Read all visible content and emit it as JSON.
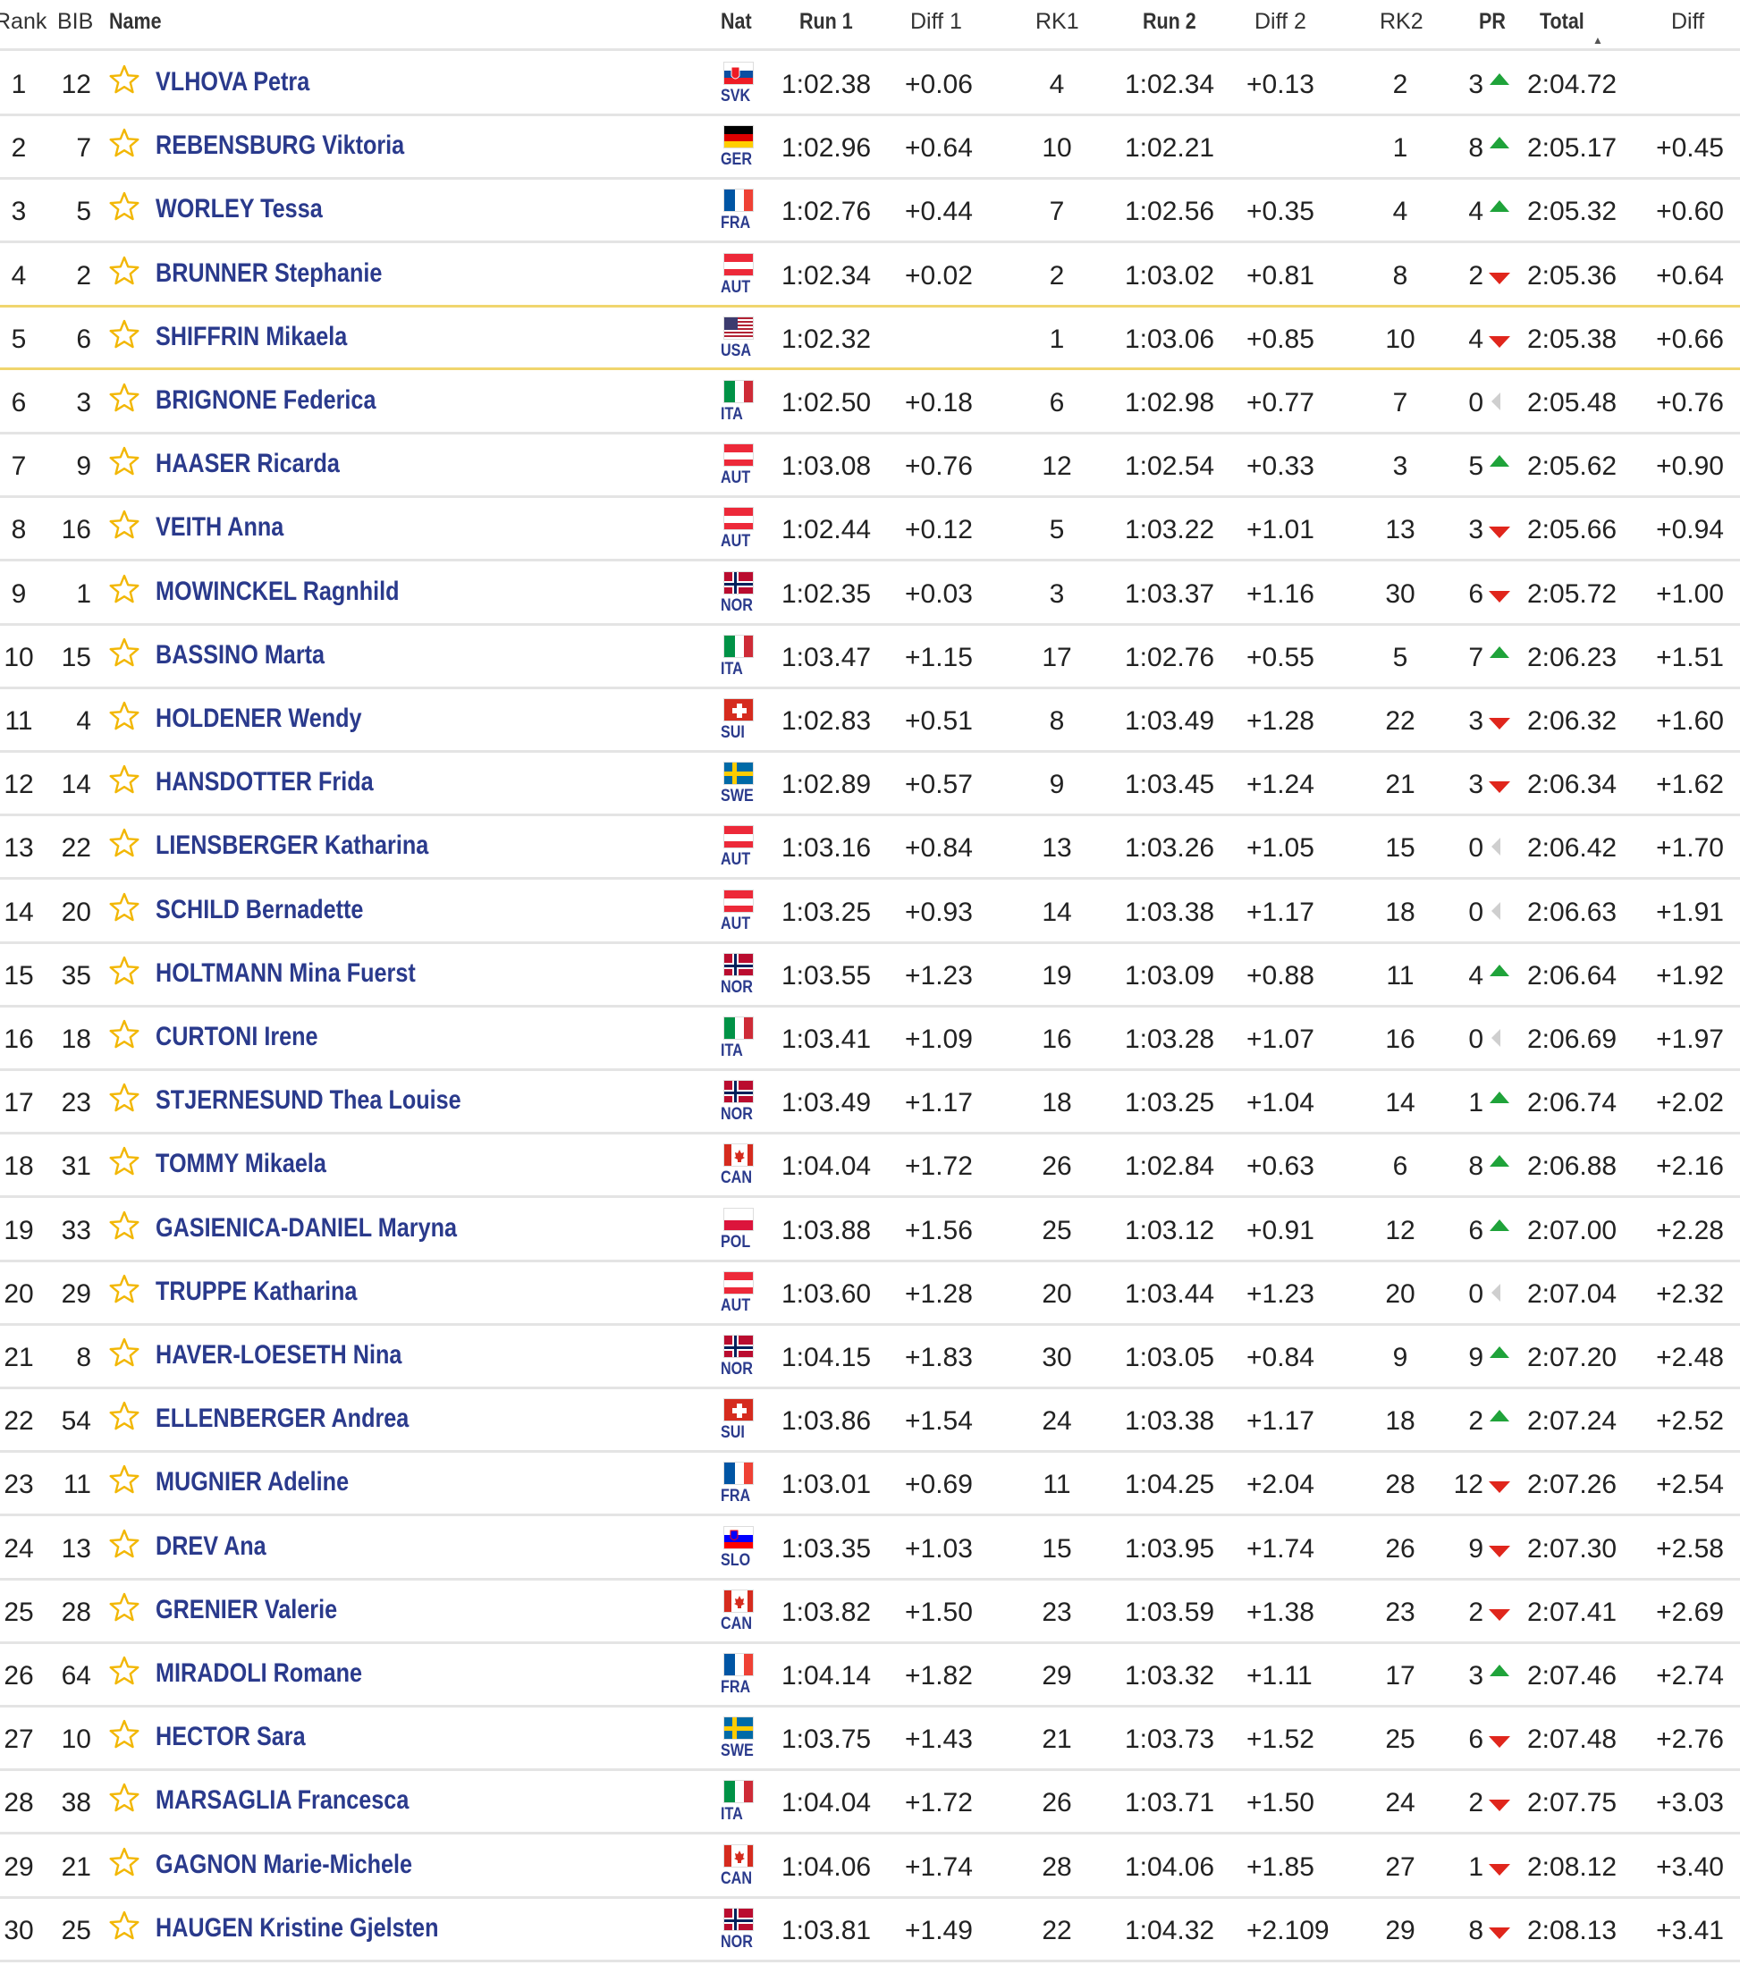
{
  "headers": {
    "rank": "Rank",
    "bib": "BIB",
    "name": "Name",
    "nat": "Nat",
    "run1": "Run 1",
    "diff1": "Diff 1",
    "rk1": "RK1",
    "run2": "Run 2",
    "diff2": "Diff 2",
    "rk2": "RK2",
    "pr": "PR",
    "total": "Total",
    "diff": "Diff"
  },
  "colors": {
    "name": "#2a3a8c",
    "up": "#1fa33a",
    "down": "#e0261c",
    "star": "#f2b705",
    "highlight": "#f0d56e"
  },
  "rows": [
    {
      "rank": "1",
      "bib": "12",
      "name": "VLHOVA Petra",
      "nat": "SVK",
      "run1": "1:02.38",
      "diff1": "+0.06",
      "rk1": "4",
      "run2": "1:02.34",
      "diff2": "+0.13",
      "rk2": "2",
      "pr": "3",
      "trend": "up",
      "total": "2:04.72",
      "diff": ""
    },
    {
      "rank": "2",
      "bib": "7",
      "name": "REBENSBURG Viktoria",
      "nat": "GER",
      "run1": "1:02.96",
      "diff1": "+0.64",
      "rk1": "10",
      "run2": "1:02.21",
      "diff2": "",
      "rk2": "1",
      "pr": "8",
      "trend": "up",
      "total": "2:05.17",
      "diff": "+0.45"
    },
    {
      "rank": "3",
      "bib": "5",
      "name": "WORLEY Tessa",
      "nat": "FRA",
      "run1": "1:02.76",
      "diff1": "+0.44",
      "rk1": "7",
      "run2": "1:02.56",
      "diff2": "+0.35",
      "rk2": "4",
      "pr": "4",
      "trend": "up",
      "total": "2:05.32",
      "diff": "+0.60"
    },
    {
      "rank": "4",
      "bib": "2",
      "name": "BRUNNER Stephanie",
      "nat": "AUT",
      "run1": "1:02.34",
      "diff1": "+0.02",
      "rk1": "2",
      "run2": "1:03.02",
      "diff2": "+0.81",
      "rk2": "8",
      "pr": "2",
      "trend": "down",
      "total": "2:05.36",
      "diff": "+0.64"
    },
    {
      "rank": "5",
      "bib": "6",
      "name": "SHIFFRIN Mikaela",
      "nat": "USA",
      "run1": "1:02.32",
      "diff1": "",
      "rk1": "1",
      "run2": "1:03.06",
      "diff2": "+0.85",
      "rk2": "10",
      "pr": "4",
      "trend": "down",
      "total": "2:05.38",
      "diff": "+0.66",
      "highlight": true
    },
    {
      "rank": "6",
      "bib": "3",
      "name": "BRIGNONE Federica",
      "nat": "ITA",
      "run1": "1:02.50",
      "diff1": "+0.18",
      "rk1": "6",
      "run2": "1:02.98",
      "diff2": "+0.77",
      "rk2": "7",
      "pr": "0",
      "trend": "same",
      "total": "2:05.48",
      "diff": "+0.76"
    },
    {
      "rank": "7",
      "bib": "9",
      "name": "HAASER Ricarda",
      "nat": "AUT",
      "run1": "1:03.08",
      "diff1": "+0.76",
      "rk1": "12",
      "run2": "1:02.54",
      "diff2": "+0.33",
      "rk2": "3",
      "pr": "5",
      "trend": "up",
      "total": "2:05.62",
      "diff": "+0.90"
    },
    {
      "rank": "8",
      "bib": "16",
      "name": "VEITH Anna",
      "nat": "AUT",
      "run1": "1:02.44",
      "diff1": "+0.12",
      "rk1": "5",
      "run2": "1:03.22",
      "diff2": "+1.01",
      "rk2": "13",
      "pr": "3",
      "trend": "down",
      "total": "2:05.66",
      "diff": "+0.94"
    },
    {
      "rank": "9",
      "bib": "1",
      "name": "MOWINCKEL Ragnhild",
      "nat": "NOR",
      "run1": "1:02.35",
      "diff1": "+0.03",
      "rk1": "3",
      "run2": "1:03.37",
      "diff2": "+1.16",
      "rk2": "30",
      "pr": "6",
      "trend": "down",
      "total": "2:05.72",
      "diff": "+1.00"
    },
    {
      "rank": "10",
      "bib": "15",
      "name": "BASSINO Marta",
      "nat": "ITA",
      "run1": "1:03.47",
      "diff1": "+1.15",
      "rk1": "17",
      "run2": "1:02.76",
      "diff2": "+0.55",
      "rk2": "5",
      "pr": "7",
      "trend": "up",
      "total": "2:06.23",
      "diff": "+1.51"
    },
    {
      "rank": "11",
      "bib": "4",
      "name": "HOLDENER Wendy",
      "nat": "SUI",
      "run1": "1:02.83",
      "diff1": "+0.51",
      "rk1": "8",
      "run2": "1:03.49",
      "diff2": "+1.28",
      "rk2": "22",
      "pr": "3",
      "trend": "down",
      "total": "2:06.32",
      "diff": "+1.60"
    },
    {
      "rank": "12",
      "bib": "14",
      "name": "HANSDOTTER Frida",
      "nat": "SWE",
      "run1": "1:02.89",
      "diff1": "+0.57",
      "rk1": "9",
      "run2": "1:03.45",
      "diff2": "+1.24",
      "rk2": "21",
      "pr": "3",
      "trend": "down",
      "total": "2:06.34",
      "diff": "+1.62"
    },
    {
      "rank": "13",
      "bib": "22",
      "name": "LIENSBERGER Katharina",
      "nat": "AUT",
      "run1": "1:03.16",
      "diff1": "+0.84",
      "rk1": "13",
      "run2": "1:03.26",
      "diff2": "+1.05",
      "rk2": "15",
      "pr": "0",
      "trend": "same",
      "total": "2:06.42",
      "diff": "+1.70"
    },
    {
      "rank": "14",
      "bib": "20",
      "name": "SCHILD Bernadette",
      "nat": "AUT",
      "run1": "1:03.25",
      "diff1": "+0.93",
      "rk1": "14",
      "run2": "1:03.38",
      "diff2": "+1.17",
      "rk2": "18",
      "pr": "0",
      "trend": "same",
      "total": "2:06.63",
      "diff": "+1.91"
    },
    {
      "rank": "15",
      "bib": "35",
      "name": "HOLTMANN Mina Fuerst",
      "nat": "NOR",
      "run1": "1:03.55",
      "diff1": "+1.23",
      "rk1": "19",
      "run2": "1:03.09",
      "diff2": "+0.88",
      "rk2": "11",
      "pr": "4",
      "trend": "up",
      "total": "2:06.64",
      "diff": "+1.92"
    },
    {
      "rank": "16",
      "bib": "18",
      "name": "CURTONI Irene",
      "nat": "ITA",
      "run1": "1:03.41",
      "diff1": "+1.09",
      "rk1": "16",
      "run2": "1:03.28",
      "diff2": "+1.07",
      "rk2": "16",
      "pr": "0",
      "trend": "same",
      "total": "2:06.69",
      "diff": "+1.97"
    },
    {
      "rank": "17",
      "bib": "23",
      "name": "STJERNESUND Thea Louise",
      "nat": "NOR",
      "run1": "1:03.49",
      "diff1": "+1.17",
      "rk1": "18",
      "run2": "1:03.25",
      "diff2": "+1.04",
      "rk2": "14",
      "pr": "1",
      "trend": "up",
      "total": "2:06.74",
      "diff": "+2.02"
    },
    {
      "rank": "18",
      "bib": "31",
      "name": "TOMMY Mikaela",
      "nat": "CAN",
      "run1": "1:04.04",
      "diff1": "+1.72",
      "rk1": "26",
      "run2": "1:02.84",
      "diff2": "+0.63",
      "rk2": "6",
      "pr": "8",
      "trend": "up",
      "total": "2:06.88",
      "diff": "+2.16"
    },
    {
      "rank": "19",
      "bib": "33",
      "name": "GASIENICA-DANIEL Maryna",
      "nat": "POL",
      "run1": "1:03.88",
      "diff1": "+1.56",
      "rk1": "25",
      "run2": "1:03.12",
      "diff2": "+0.91",
      "rk2": "12",
      "pr": "6",
      "trend": "up",
      "total": "2:07.00",
      "diff": "+2.28"
    },
    {
      "rank": "20",
      "bib": "29",
      "name": "TRUPPE Katharina",
      "nat": "AUT",
      "run1": "1:03.60",
      "diff1": "+1.28",
      "rk1": "20",
      "run2": "1:03.44",
      "diff2": "+1.23",
      "rk2": "20",
      "pr": "0",
      "trend": "same",
      "total": "2:07.04",
      "diff": "+2.32"
    },
    {
      "rank": "21",
      "bib": "8",
      "name": "HAVER-LOESETH Nina",
      "nat": "NOR",
      "run1": "1:04.15",
      "diff1": "+1.83",
      "rk1": "30",
      "run2": "1:03.05",
      "diff2": "+0.84",
      "rk2": "9",
      "pr": "9",
      "trend": "up",
      "total": "2:07.20",
      "diff": "+2.48"
    },
    {
      "rank": "22",
      "bib": "54",
      "name": "ELLENBERGER Andrea",
      "nat": "SUI",
      "run1": "1:03.86",
      "diff1": "+1.54",
      "rk1": "24",
      "run2": "1:03.38",
      "diff2": "+1.17",
      "rk2": "18",
      "pr": "2",
      "trend": "up",
      "total": "2:07.24",
      "diff": "+2.52"
    },
    {
      "rank": "23",
      "bib": "11",
      "name": "MUGNIER Adeline",
      "nat": "FRA",
      "run1": "1:03.01",
      "diff1": "+0.69",
      "rk1": "11",
      "run2": "1:04.25",
      "diff2": "+2.04",
      "rk2": "28",
      "pr": "12",
      "trend": "down",
      "total": "2:07.26",
      "diff": "+2.54"
    },
    {
      "rank": "24",
      "bib": "13",
      "name": "DREV Ana",
      "nat": "SLO",
      "run1": "1:03.35",
      "diff1": "+1.03",
      "rk1": "15",
      "run2": "1:03.95",
      "diff2": "+1.74",
      "rk2": "26",
      "pr": "9",
      "trend": "down",
      "total": "2:07.30",
      "diff": "+2.58"
    },
    {
      "rank": "25",
      "bib": "28",
      "name": "GRENIER Valerie",
      "nat": "CAN",
      "run1": "1:03.82",
      "diff1": "+1.50",
      "rk1": "23",
      "run2": "1:03.59",
      "diff2": "+1.38",
      "rk2": "23",
      "pr": "2",
      "trend": "down",
      "total": "2:07.41",
      "diff": "+2.69"
    },
    {
      "rank": "26",
      "bib": "64",
      "name": "MIRADOLI Romane",
      "nat": "FRA",
      "run1": "1:04.14",
      "diff1": "+1.82",
      "rk1": "29",
      "run2": "1:03.32",
      "diff2": "+1.11",
      "rk2": "17",
      "pr": "3",
      "trend": "up",
      "total": "2:07.46",
      "diff": "+2.74"
    },
    {
      "rank": "27",
      "bib": "10",
      "name": "HECTOR Sara",
      "nat": "SWE",
      "run1": "1:03.75",
      "diff1": "+1.43",
      "rk1": "21",
      "run2": "1:03.73",
      "diff2": "+1.52",
      "rk2": "25",
      "pr": "6",
      "trend": "down",
      "total": "2:07.48",
      "diff": "+2.76"
    },
    {
      "rank": "28",
      "bib": "38",
      "name": "MARSAGLIA Francesca",
      "nat": "ITA",
      "run1": "1:04.04",
      "diff1": "+1.72",
      "rk1": "26",
      "run2": "1:03.71",
      "diff2": "+1.50",
      "rk2": "24",
      "pr": "2",
      "trend": "down",
      "total": "2:07.75",
      "diff": "+3.03"
    },
    {
      "rank": "29",
      "bib": "21",
      "name": "GAGNON Marie-Michele",
      "nat": "CAN",
      "run1": "1:04.06",
      "diff1": "+1.74",
      "rk1": "28",
      "run2": "1:04.06",
      "diff2": "+1.85",
      "rk2": "27",
      "pr": "1",
      "trend": "down",
      "total": "2:08.12",
      "diff": "+3.40"
    },
    {
      "rank": "30",
      "bib": "25",
      "name": "HAUGEN Kristine Gjelsten",
      "nat": "NOR",
      "run1": "1:03.81",
      "diff1": "+1.49",
      "rk1": "22",
      "run2": "1:04.32",
      "diff2": "+2.109",
      "rk2": "29",
      "pr": "8",
      "trend": "down",
      "total": "2:08.13",
      "diff": "+3.41"
    }
  ]
}
